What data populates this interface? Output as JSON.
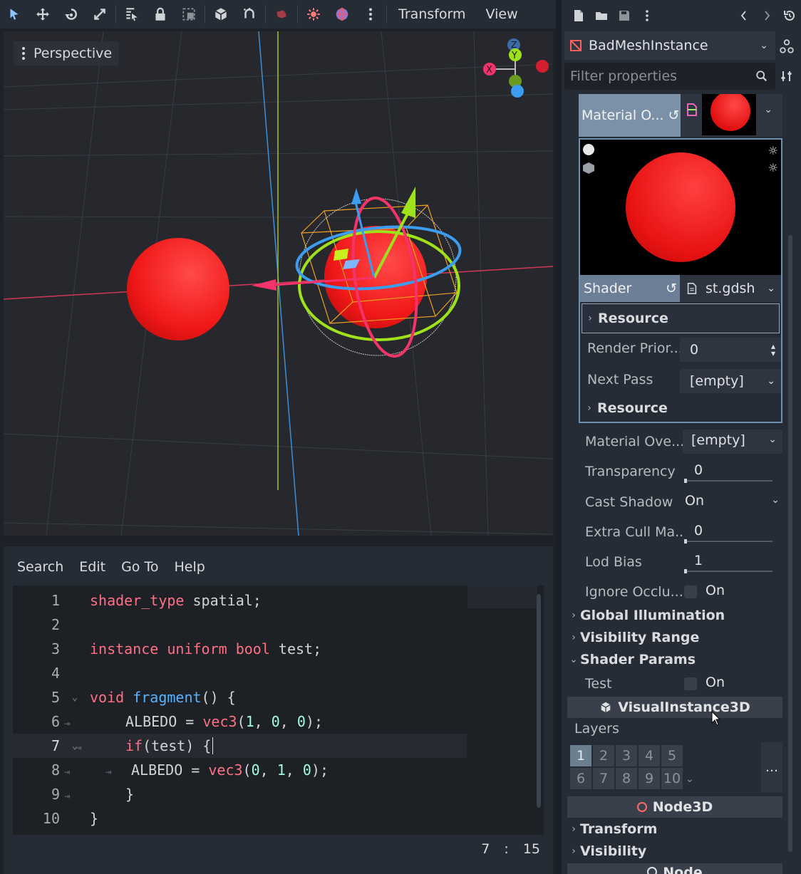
{
  "toolbar": {
    "menus": [
      "Transform",
      "View"
    ]
  },
  "viewport": {
    "perspective_label": "Perspective",
    "gizmo": {
      "x": "X",
      "y": "Y",
      "z": "Z"
    }
  },
  "code_editor": {
    "menus": [
      "Search",
      "Edit",
      "Go To",
      "Help"
    ],
    "lines": [
      {
        "n": "1",
        "text": "shader_type spatial;"
      },
      {
        "n": "2",
        "text": ""
      },
      {
        "n": "3",
        "text": "instance uniform bool test;"
      },
      {
        "n": "4",
        "text": ""
      },
      {
        "n": "5",
        "text": "void fragment() {"
      },
      {
        "n": "6",
        "text": "ALBEDO = vec3(1, 0, 0);"
      },
      {
        "n": "7",
        "text": "if(test) {"
      },
      {
        "n": "8",
        "text": "ALBEDO = vec3(0, 1, 0);"
      },
      {
        "n": "9",
        "text": "}"
      },
      {
        "n": "10",
        "text": "}"
      }
    ],
    "caret_line": "7",
    "caret_sep": ":",
    "caret_col": "15"
  },
  "inspector": {
    "node_name": "BadMeshInstance",
    "filter_placeholder": "Filter properties",
    "material_override_label": "Material O...",
    "shader_label": "Shader",
    "shader_file": "st.gdsh",
    "resource_label_1": "Resource",
    "render_priority_label": "Render Prior...",
    "render_priority_value": "0",
    "next_pass_label": "Next Pass",
    "next_pass_value": "[empty]",
    "resource_label_2": "Resource",
    "props": [
      {
        "label": "Material Ove...",
        "value": "[empty]"
      },
      {
        "label": "Transparency",
        "value": "0"
      },
      {
        "label": "Cast Shadow",
        "value": "On"
      },
      {
        "label": "Extra Cull Ma...",
        "value": "0"
      },
      {
        "label": "Lod Bias",
        "value": "1"
      },
      {
        "label": "Ignore Occlu...",
        "value": "On"
      }
    ],
    "sections": {
      "global_illumination": "Global Illumination",
      "visibility_range": "Visibility Range",
      "shader_params": "Shader Params"
    },
    "test_label": "Test",
    "test_value": "On",
    "class_visual": "VisualInstance3D",
    "layers_label": "Layers",
    "layers": [
      "1",
      "2",
      "3",
      "4",
      "5",
      "6",
      "7",
      "8",
      "9",
      "10"
    ],
    "layers_more": "...",
    "class_node3d": "Node3D",
    "transform_label": "Transform",
    "visibility_label": "Visibility",
    "class_node": "Node"
  },
  "colors": {
    "accent_red": "#ff2f2f",
    "axis_x": "#f5336b",
    "axis_y": "#9fe21a",
    "axis_z": "#3b9cf0"
  }
}
